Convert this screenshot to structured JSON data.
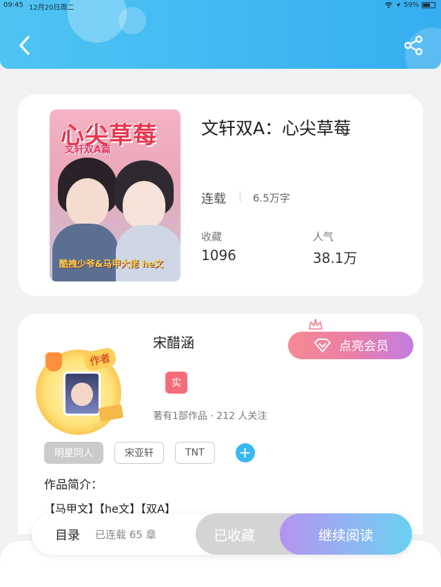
{
  "status_bar": {
    "time": "09:45",
    "date": "12月20日周二",
    "battery": "59%"
  },
  "book": {
    "title": "文轩双A：心尖草莓",
    "status": "连载",
    "word_count": "6.5万字",
    "favorites_label": "收藏",
    "favorites_value": "1096",
    "popularity_label": "人气",
    "popularity_value": "38.1万",
    "cover": {
      "main_title": "心尖草莓",
      "subtitle": "文轩双A篇",
      "bottom_text": "酷拽少爷&马甲大佬 he文"
    }
  },
  "author": {
    "name": "宋醋涵",
    "verified_badge": "实",
    "stats": "著有1部作品 · 212 人关注",
    "avatar_tag": "作者",
    "vip_button": "点亮会员"
  },
  "tags": [
    "明星同人",
    "宋亚轩",
    "TNT"
  ],
  "add_tag_label": "+",
  "intro": {
    "label": "作品简介：",
    "text": "【马甲文】【he文】【双A】"
  },
  "bottom_bar": {
    "catalog_label": "目录",
    "catalog_count": "已连载 65 章",
    "collected_label": "已收藏",
    "continue_label": "继续阅读"
  },
  "colors": {
    "header": "#36aef0",
    "vip_gradient_start": "#f58a93",
    "vip_gradient_end": "#c17ee3",
    "read_gradient_start": "#b493f0",
    "read_gradient_end": "#6ad1f2",
    "verified_badge": "#f46c78",
    "add_tag": "#37b8f0"
  },
  "icons": {
    "back": "chevron-left-icon",
    "share": "share-icon",
    "wifi": "wifi-icon",
    "battery": "battery-icon",
    "crown": "crown-icon",
    "diamond": "diamond-icon",
    "add": "plus-icon"
  }
}
